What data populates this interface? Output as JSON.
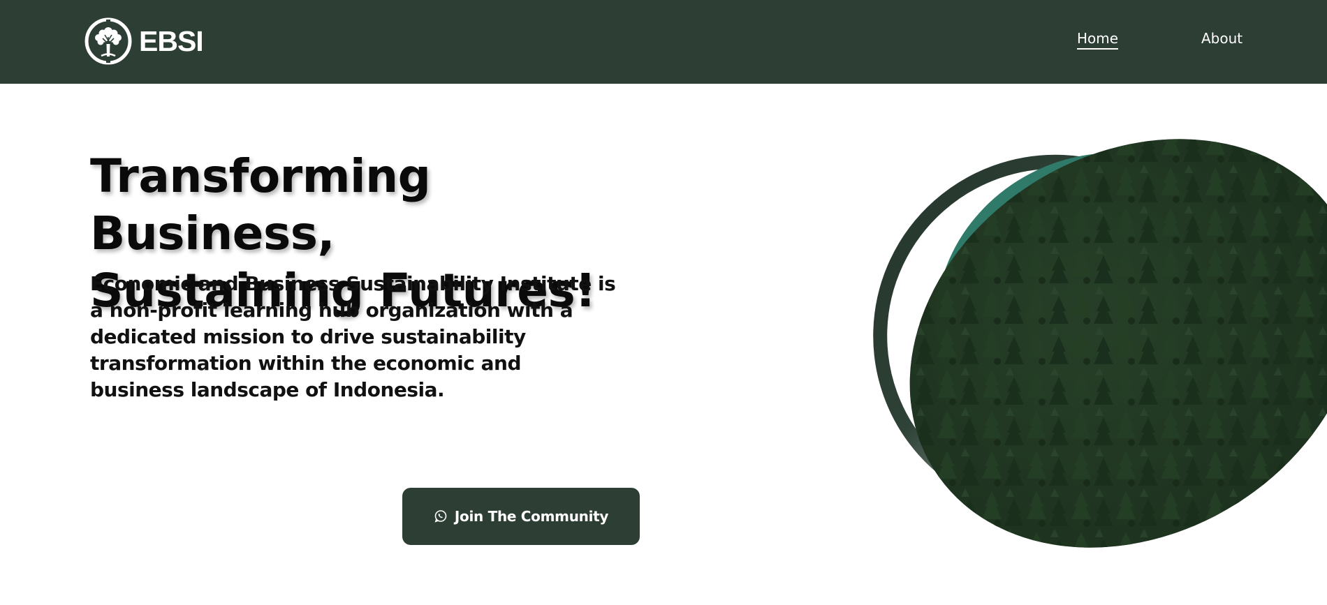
{
  "nav": {
    "logo_text": "EBSI",
    "logo_icon": "tree-circle-logo-icon",
    "links": [
      {
        "label": "Home",
        "active": true
      },
      {
        "label": "About",
        "active": false
      }
    ]
  },
  "hero": {
    "headline_line1": "Transforming Business,",
    "headline_line2": "Sustaining Futures!",
    "description": "Economic and Business Sustainability Institute is a non-profit learning hub organization with a dedicated mission to drive sustainability transformation within the economic and business landscape of Indonesia.",
    "cta": {
      "label": "Join The Community",
      "icon": "whatsapp-icon"
    },
    "image_alt": "forest-aerial-image"
  },
  "colors": {
    "brand_dark_green": "#2d3f35",
    "accent_teal": "#2f7a68",
    "white": "#ffffff",
    "text_dark": "#0a0a0a"
  }
}
